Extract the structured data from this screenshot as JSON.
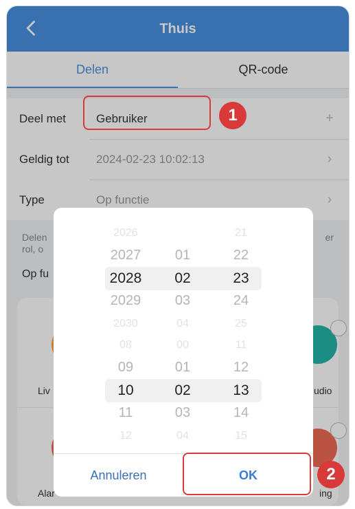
{
  "header": {
    "title": "Thuis"
  },
  "tabs": [
    {
      "label": "Delen"
    },
    {
      "label": "QR-code"
    }
  ],
  "form": {
    "share_with": {
      "label": "Deel met",
      "value": "Gebruiker",
      "trailing": "+"
    },
    "valid_until": {
      "label": "Geldig tot",
      "value": "2024-02-23 10:02:13",
      "trailing": "›"
    },
    "type": {
      "label": "Type",
      "value": "Op functie",
      "trailing": "›"
    }
  },
  "desc": {
    "line1": "Delen",
    "line2": "rol, o",
    "line1_right": "er"
  },
  "section": {
    "label": "Op fu"
  },
  "cards": {
    "live": "Liv",
    "audio": "udio",
    "alarm": "Alar",
    "alarm_right": "ing"
  },
  "picker_top": {
    "year": [
      "2026",
      "2027",
      "2028",
      "2029",
      "2030"
    ],
    "month": [
      "",
      "01",
      "02",
      "03",
      "04"
    ],
    "day": [
      "21",
      "22",
      "23",
      "24",
      "25"
    ]
  },
  "picker_bottom": {
    "hour": [
      "08",
      "09",
      "10",
      "11",
      "12"
    ],
    "minute": [
      "00",
      "01",
      "02",
      "03",
      "04"
    ],
    "second": [
      "11",
      "12",
      "13",
      "14",
      "15"
    ]
  },
  "dialog": {
    "cancel": "Annuleren",
    "ok": "OK"
  },
  "badges": {
    "one": "1",
    "two": "2"
  },
  "colors": {
    "header": "#4a90e2",
    "highlight": "#d83a3a",
    "ok": "#3a7bd5"
  }
}
